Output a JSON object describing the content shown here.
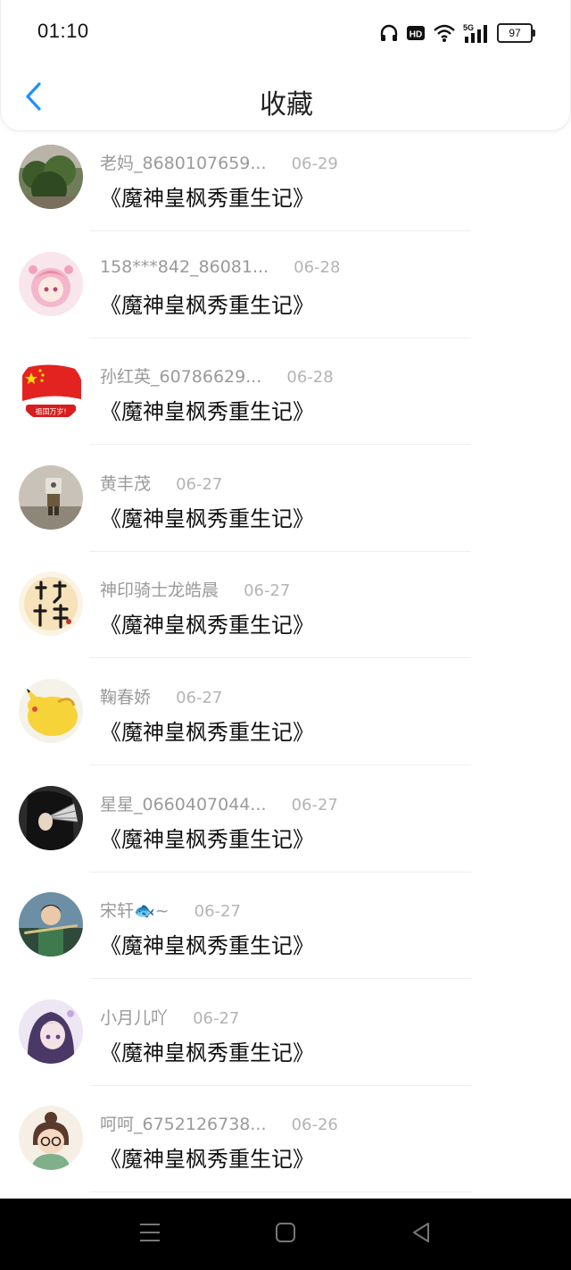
{
  "status_bar": {
    "time": "01:10",
    "icons": [
      "headphones-icon",
      "hd-icon",
      "wifi-icon",
      "5g-signal-icon"
    ],
    "network": "5G",
    "battery": "97"
  },
  "header": {
    "back_icon": "chevron-left-icon",
    "title": "收藏",
    "accent_color": "#1e90ff"
  },
  "favorites": [
    {
      "user": "老妈_8680107659...",
      "date": "06-29",
      "title": "《魔神皇枫秀重生记》",
      "avatar": "plants-photo"
    },
    {
      "user": "158***842_86081...",
      "date": "06-28",
      "title": "《魔神皇枫秀重生记》",
      "avatar": "anime-girl-pink"
    },
    {
      "user": "孙红英_60786629...",
      "date": "06-28",
      "title": "《魔神皇枫秀重生记》",
      "avatar": "red-flag",
      "avatar_text": "祖国万岁!"
    },
    {
      "user": "黄丰茂",
      "date": "06-27",
      "title": "《魔神皇枫秀重生记》",
      "avatar": "toy-figure"
    },
    {
      "user": "神印骑士龙皓晨",
      "date": "06-27",
      "title": "《魔神皇枫秀重生记》",
      "avatar": "calligraphy"
    },
    {
      "user": "鞠春娇",
      "date": "06-27",
      "title": "《魔神皇枫秀重生记》",
      "avatar": "pikachu"
    },
    {
      "user": "星星_0660407044...",
      "date": "06-27",
      "title": "《魔神皇枫秀重生记》",
      "avatar": "fan-portrait"
    },
    {
      "user": "宋轩🐟~",
      "date": "06-27",
      "title": "《魔神皇枫秀重生记》",
      "avatar": "boy-flute"
    },
    {
      "user": "小月儿吖",
      "date": "06-27",
      "title": "《魔神皇枫秀重生记》",
      "avatar": "anime-girl-purple"
    },
    {
      "user": "呵呵_6752126738...",
      "date": "06-26",
      "title": "《魔神皇枫秀重生记》",
      "avatar": "cartoon-girl-glasses"
    }
  ],
  "nav_bar": {
    "buttons": [
      "menu-icon",
      "home-icon",
      "back-triangle-icon"
    ]
  }
}
